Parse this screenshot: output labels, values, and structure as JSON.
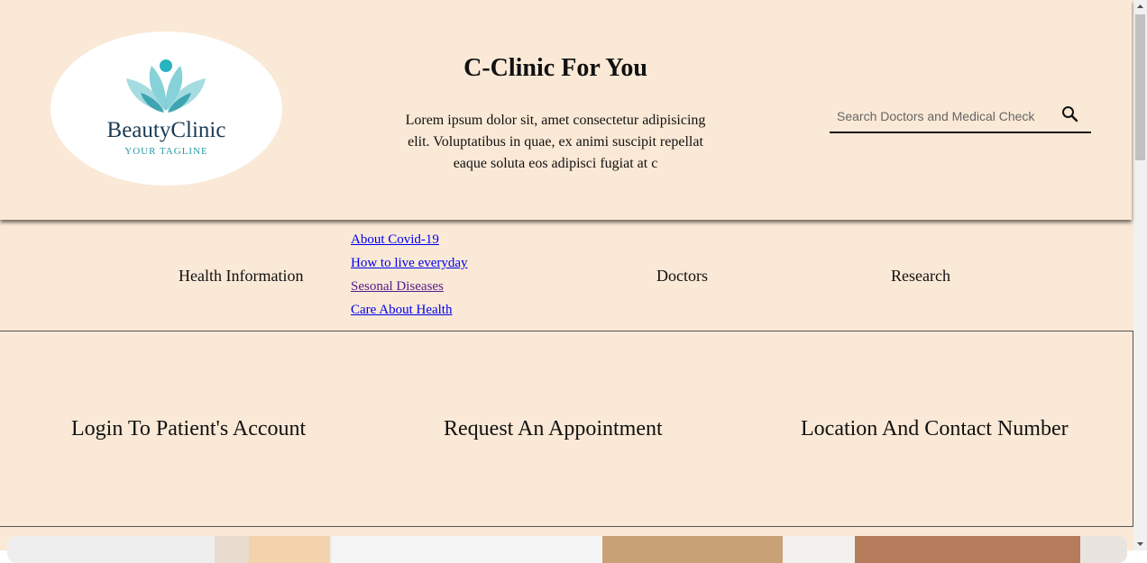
{
  "header": {
    "logo": {
      "name": "BeautyClinic",
      "tagline": "YOUR TAGLINE",
      "icon": "lotus-logo-icon"
    },
    "title": "C-Clinic For You",
    "intro": "Lorem ipsum dolor sit, amet consectetur adipisicing elit. Voluptatibus in quae, ex animi suscipit repellat eaque soluta eos adipisci fugiat at c",
    "search": {
      "placeholder": "Search Doctors and Medical Check",
      "icon": "search-icon"
    }
  },
  "nav": {
    "health_info": "Health Information",
    "submenu": [
      "About Covid-19",
      "How to live everyday",
      "Sesonal Diseases",
      "Care About Health"
    ],
    "doctors": "Doctors",
    "research": "Research"
  },
  "actions": {
    "login": "Login To Patient's Account",
    "appointment": "Request An Appointment",
    "location": "Location And Contact Number"
  },
  "colors": {
    "background": "#fae9d6",
    "link": "#0000ee",
    "visited_link": "#551a8b",
    "logo_teal": "#2a9aa8"
  }
}
